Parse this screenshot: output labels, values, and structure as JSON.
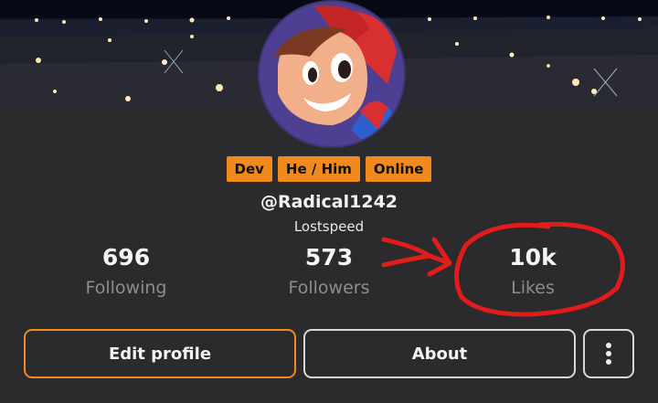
{
  "profile": {
    "badges": [
      "Dev",
      "He / Him",
      "Online"
    ],
    "username": "@Radical1242",
    "display_name": "Lostspeed"
  },
  "stats": [
    {
      "value": "696",
      "label": "Following"
    },
    {
      "value": "573",
      "label": "Followers"
    },
    {
      "value": "10k",
      "label": "Likes"
    }
  ],
  "actions": {
    "edit_label": "Edit profile",
    "about_label": "About",
    "more_icon": "kebab-menu-icon"
  },
  "colors": {
    "accent": "#f08a1c",
    "background": "#2b2a2c",
    "annotation": "#e21b1b"
  }
}
